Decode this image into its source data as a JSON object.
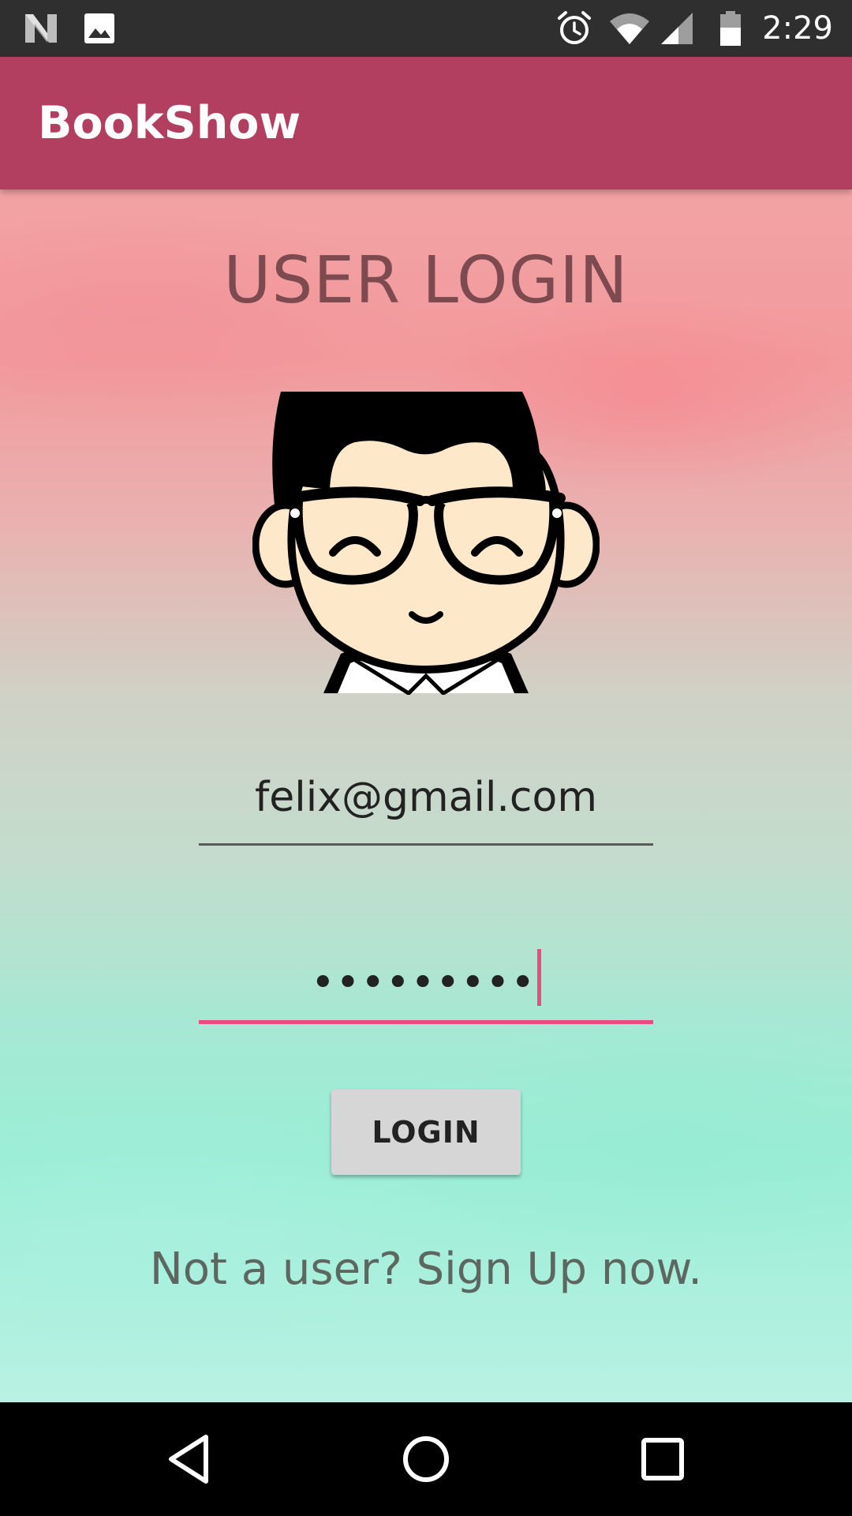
{
  "status_bar": {
    "time": "2:29",
    "icons": [
      "notification-n-icon",
      "image-notification-icon",
      "alarm-icon",
      "wifi-icon",
      "cell-signal-icon",
      "battery-icon"
    ]
  },
  "app_bar": {
    "title": "BookShow",
    "color": "#b33f60"
  },
  "login": {
    "heading": "USER LOGIN",
    "avatar_icon": "user-avatar",
    "email_value": "felix@gmail.com",
    "password_masked": "•••••••••",
    "login_button": "LOGIN",
    "signup_text": "Not a user? Sign Up now.",
    "accent_color": "#ea4c80"
  },
  "nav_bar": {
    "icons": [
      "back-icon",
      "home-icon",
      "recents-icon"
    ]
  }
}
